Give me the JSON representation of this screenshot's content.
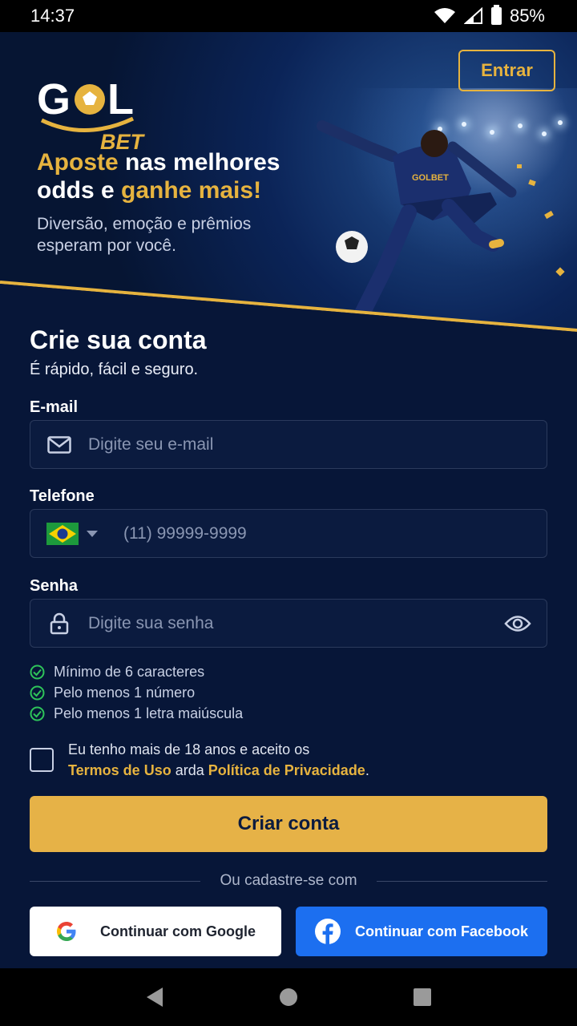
{
  "status_bar": {
    "time": "14:37",
    "battery": "85%"
  },
  "header": {
    "logo_text": "GOL",
    "logo_sub": "BET",
    "login_label": "Entrar"
  },
  "hero": {
    "headline_gold1": "Aposte",
    "headline_white1": " nas melhores",
    "headline_white2": "odds e ",
    "headline_gold2": "ganhe mais!",
    "subtext": "Diversão, emoção e prêmios esperam por você.",
    "jersey_text": "GOLBET"
  },
  "form": {
    "title": "Crie sua conta",
    "subtitle": "É rápido, fácil e seguro.",
    "email_label": "E-mail",
    "email_placeholder": "Digite seu e-mail",
    "phone_label": "Telefone",
    "phone_placeholder": "(11) 99999-9999",
    "password_label": "Senha",
    "password_placeholder": "Digite sua senha",
    "rules": [
      "Mínimo de 6 caracteres",
      "Pelo menos 1 número",
      "Pelo menos 1 letra maiúscula"
    ],
    "terms_prefix": "Eu tenho mais de 18 anos e aceito os",
    "terms_link": "Termos de Uso",
    "terms_mid": " arda ",
    "privacy_link": "Política de Privacidade",
    "terms_end": ".",
    "submit_label": "Criar conta",
    "or_label": "Ou cadastre-se com",
    "google_label": "Continuar com Google",
    "facebook_label": "Continuar com Facebook"
  },
  "colors": {
    "accent": "#e6b33f",
    "background": "#071638",
    "facebook": "#1c6ff0",
    "check": "#2ec45a"
  }
}
